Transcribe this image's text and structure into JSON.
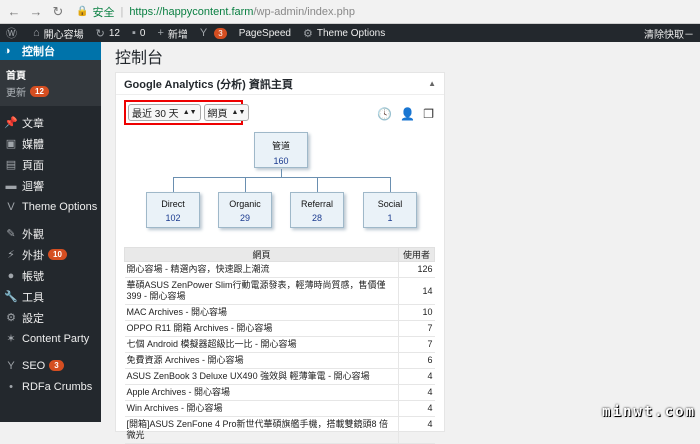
{
  "browser": {
    "secure_label": "安全",
    "url_host": "https://happycontent.farm",
    "url_path": "/wp-admin/index.php"
  },
  "adminbar": {
    "site_name": "開心容場",
    "updates_count": "12",
    "comments_count": "0",
    "new_label": "新增",
    "yoast_count": "3",
    "pagespeed_label": "PageSpeed",
    "theme_options_label": "Theme Options",
    "right_text": "清除快取－"
  },
  "sidebar": {
    "current": "控制台",
    "sub": [
      "首頁",
      "更新"
    ],
    "updates_badge": "12",
    "items": [
      {
        "label": "文章",
        "icon": "pin-icon"
      },
      {
        "label": "媒體",
        "icon": "media-icon"
      },
      {
        "label": "頁面",
        "icon": "page-icon"
      },
      {
        "label": "迴響",
        "icon": "comment-icon"
      },
      {
        "label": "Theme Options",
        "icon": "v-icon"
      },
      {
        "label": "外觀",
        "icon": "brush-icon"
      },
      {
        "label": "外掛",
        "icon": "plugin-icon",
        "badge": "10"
      },
      {
        "label": "帳號",
        "icon": "user-icon"
      },
      {
        "label": "工具",
        "icon": "wrench-icon"
      },
      {
        "label": "設定",
        "icon": "settings-icon"
      },
      {
        "label": "Content Party",
        "icon": "party-icon"
      },
      {
        "label": "SEO",
        "icon": "yoast-icon",
        "badge": "3"
      },
      {
        "label": "RDFa Crumbs",
        "icon": "dot-icon"
      }
    ]
  },
  "main": {
    "page_title": "控制台",
    "widget_title": "Google Analytics (分析) 資訊主頁",
    "period_select": "最近 30 天",
    "view_select": "網頁",
    "tree": {
      "root": {
        "label": "管道",
        "value": "160"
      },
      "children": [
        {
          "label": "Direct",
          "value": "102"
        },
        {
          "label": "Organic",
          "value": "29"
        },
        {
          "label": "Referral",
          "value": "28"
        },
        {
          "label": "Social",
          "value": "1"
        }
      ]
    },
    "table": {
      "headers": [
        "網頁",
        "使用者"
      ],
      "rows": [
        [
          "開心容場 - 精選內容，快速跟上潮流",
          "126"
        ],
        [
          "華碩ASUS ZenPower Slim行動電源發表，輕薄時尚質感，售價僅399 - 開心容場",
          "14"
        ],
        [
          "MAC Archives - 開心容場",
          "10"
        ],
        [
          "OPPO R11 開箱 Archives - 開心容場",
          "7"
        ],
        [
          "七個 Android 模擬器超級比一比 - 開心容場",
          "7"
        ],
        [
          "免費資源 Archives - 開心容場",
          "6"
        ],
        [
          "ASUS ZenBook 3 Deluxe UX490 強效與 輕薄筆電 - 開心容場",
          "4"
        ],
        [
          "Apple Archives - 開心容場",
          "4"
        ],
        [
          "Win Archives - 開心容場",
          "4"
        ],
        [
          "[開箱]ASUS ZenFone 4 Pro新世代華碩旗艦手機，搭載雙鏡頭8 倍微光",
          "4"
        ]
      ]
    }
  },
  "watermark": "minwt.com"
}
